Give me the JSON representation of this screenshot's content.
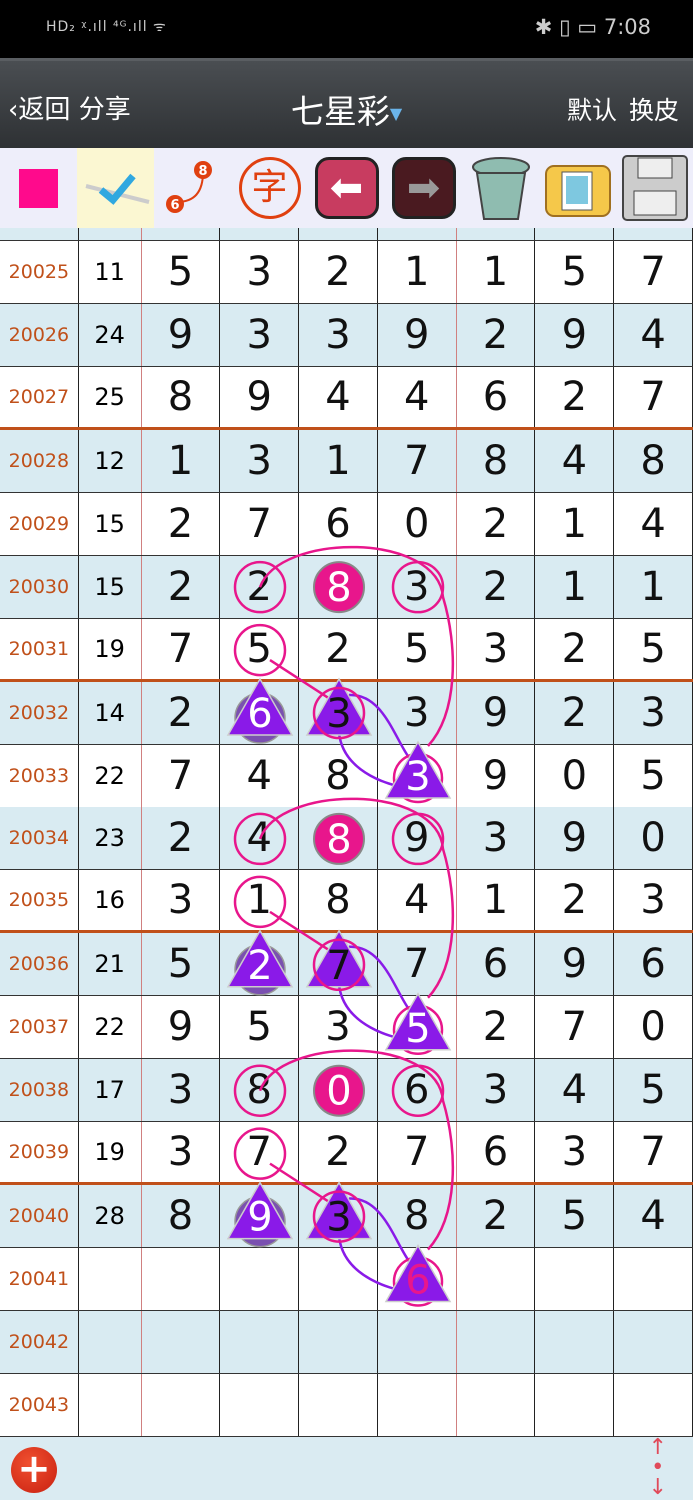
{
  "status_bar": {
    "left": "HD₂ ᵡ.ıll ⁴ᴳ.ıll ᯤ",
    "right": "✱ ▯ ▭ 7:08",
    "time": "7:08"
  },
  "nav": {
    "back_label": "返回",
    "share_label": "分享",
    "title": "七星彩",
    "default_label": "默认",
    "skin_label": "换皮"
  },
  "toolbar": {
    "items": [
      {
        "name": "color-swatch-icon",
        "color": "#ff0a8c"
      },
      {
        "name": "checkmark-icon"
      },
      {
        "name": "connect-numbers-icon",
        "from": "6",
        "to": "8"
      },
      {
        "name": "text-stamp-icon",
        "label": "字"
      },
      {
        "name": "arrow-left-icon"
      },
      {
        "name": "arrow-right-icon"
      },
      {
        "name": "trash-icon"
      },
      {
        "name": "photo-folder-icon"
      },
      {
        "name": "save-disk-icon"
      }
    ]
  },
  "colors": {
    "issue": "#c0501a",
    "circle": "#e8168c",
    "triangle": "#8a1ae8"
  },
  "rows": [
    {
      "issue": "20025",
      "sum": "11",
      "digits": [
        "5",
        "3",
        "2",
        "1",
        "1",
        "5",
        "7"
      ]
    },
    {
      "issue": "20026",
      "sum": "24",
      "digits": [
        "9",
        "3",
        "3",
        "9",
        "2",
        "9",
        "4"
      ]
    },
    {
      "issue": "20027",
      "sum": "25",
      "digits": [
        "8",
        "9",
        "4",
        "4",
        "6",
        "2",
        "7"
      ]
    },
    {
      "issue": "20028",
      "sum": "12",
      "digits": [
        "1",
        "3",
        "1",
        "7",
        "8",
        "4",
        "8"
      ]
    },
    {
      "issue": "20029",
      "sum": "15",
      "digits": [
        "2",
        "7",
        "6",
        "0",
        "2",
        "1",
        "4"
      ]
    },
    {
      "issue": "20030",
      "sum": "15",
      "digits": [
        "2",
        "2",
        "8",
        "3",
        "2",
        "1",
        "1"
      ]
    },
    {
      "issue": "20031",
      "sum": "19",
      "digits": [
        "7",
        "5",
        "2",
        "5",
        "3",
        "2",
        "5"
      ]
    },
    {
      "issue": "20032",
      "sum": "14",
      "digits": [
        "2",
        "6",
        "3",
        "3",
        "9",
        "2",
        "3"
      ]
    },
    {
      "issue": "20033",
      "sum": "22",
      "digits": [
        "7",
        "4",
        "8",
        "3",
        "9",
        "0",
        "5"
      ]
    },
    {
      "issue": "20034",
      "sum": "23",
      "digits": [
        "2",
        "4",
        "8",
        "9",
        "3",
        "9",
        "0"
      ]
    },
    {
      "issue": "20035",
      "sum": "16",
      "digits": [
        "3",
        "1",
        "8",
        "4",
        "1",
        "2",
        "3"
      ]
    },
    {
      "issue": "20036",
      "sum": "21",
      "digits": [
        "5",
        "2",
        "7",
        "7",
        "6",
        "9",
        "6"
      ]
    },
    {
      "issue": "20037",
      "sum": "22",
      "digits": [
        "9",
        "5",
        "3",
        "5",
        "2",
        "7",
        "0"
      ]
    },
    {
      "issue": "20038",
      "sum": "17",
      "digits": [
        "3",
        "8",
        "0",
        "6",
        "3",
        "4",
        "5"
      ]
    },
    {
      "issue": "20039",
      "sum": "19",
      "digits": [
        "3",
        "7",
        "2",
        "7",
        "6",
        "3",
        "7"
      ]
    },
    {
      "issue": "20040",
      "sum": "28",
      "digits": [
        "8",
        "9",
        "3",
        "8",
        "2",
        "5",
        "4"
      ]
    },
    {
      "issue": "20041",
      "sum": "",
      "digits": [
        "",
        "",
        "",
        "6",
        "",
        "",
        ""
      ]
    },
    {
      "issue": "20042",
      "sum": "",
      "digits": [
        "",
        "",
        "",
        "",
        "",
        "",
        ""
      ]
    },
    {
      "issue": "20043",
      "sum": "",
      "digits": [
        "",
        "",
        "",
        "",
        "",
        "",
        ""
      ]
    }
  ],
  "pattern_groups": [
    {
      "rows": [
        "20030",
        "20031",
        "20032",
        "20033"
      ]
    },
    {
      "rows": [
        "20034",
        "20035",
        "20036",
        "20037"
      ]
    },
    {
      "rows": [
        "20038",
        "20039",
        "20040",
        "20041"
      ]
    }
  ],
  "footer": {
    "add_icon": "plus-icon",
    "scroll_icon": "scroll-up-down-icon",
    "add_label": "+",
    "scroll_label": "↑•↓"
  }
}
